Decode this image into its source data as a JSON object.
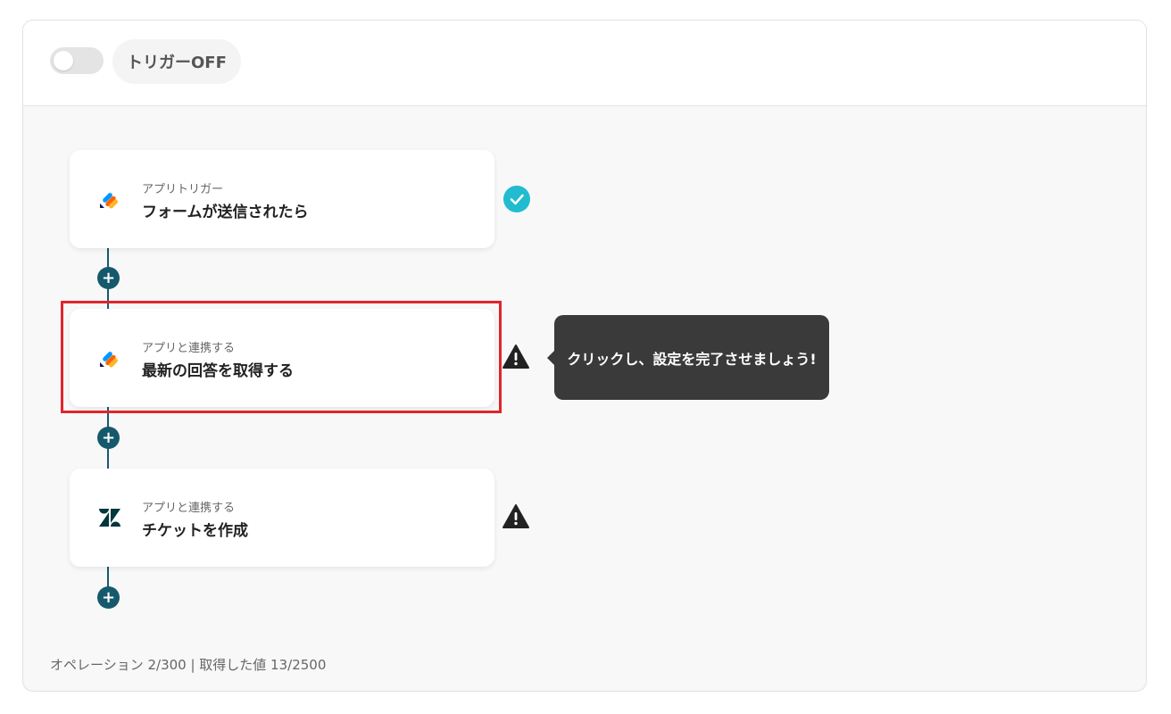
{
  "header": {
    "trigger_label": "トリガーOFF",
    "toggle_on": false
  },
  "steps": [
    {
      "subtitle": "アプリトリガー",
      "title": "フォームが送信されたら",
      "icon": "jotform-icon",
      "status": "complete"
    },
    {
      "subtitle": "アプリと連携する",
      "title": "最新の回答を取得する",
      "icon": "jotform-icon",
      "status": "warning"
    },
    {
      "subtitle": "アプリと連携する",
      "title": "チケットを作成",
      "icon": "zendesk-icon",
      "status": "warning"
    }
  ],
  "tooltip": {
    "text": "クリックし、設定を完了させましょう!"
  },
  "footer": {
    "text": "オペレーション 2/300 | 取得した値 13/2500"
  },
  "colors": {
    "connector": "#16596d",
    "check": "#21bcd0",
    "highlight": "#e0252b",
    "tooltip_bg": "#3a3a3a"
  }
}
